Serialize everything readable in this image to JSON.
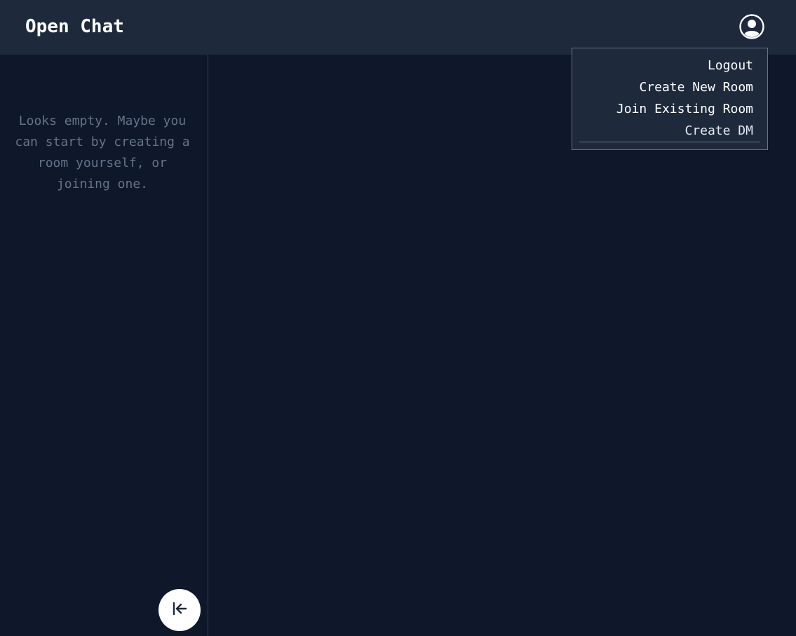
{
  "header": {
    "title": "Open Chat",
    "profile_icon": "user-circle-icon"
  },
  "sidebar": {
    "empty_message": "Looks empty. Maybe you can start by creating a room yourself, or joining one.",
    "collapse_icon": "collapse-left-icon"
  },
  "menu": {
    "items": [
      {
        "label": "Logout"
      },
      {
        "label": "Create New Room"
      },
      {
        "label": "Join Existing Room"
      },
      {
        "label": "Create DM"
      }
    ]
  },
  "colors": {
    "background": "#0f172a",
    "header": "#1e293b",
    "muted_text": "#64748b",
    "text": "#ffffff",
    "border": "#334155"
  }
}
